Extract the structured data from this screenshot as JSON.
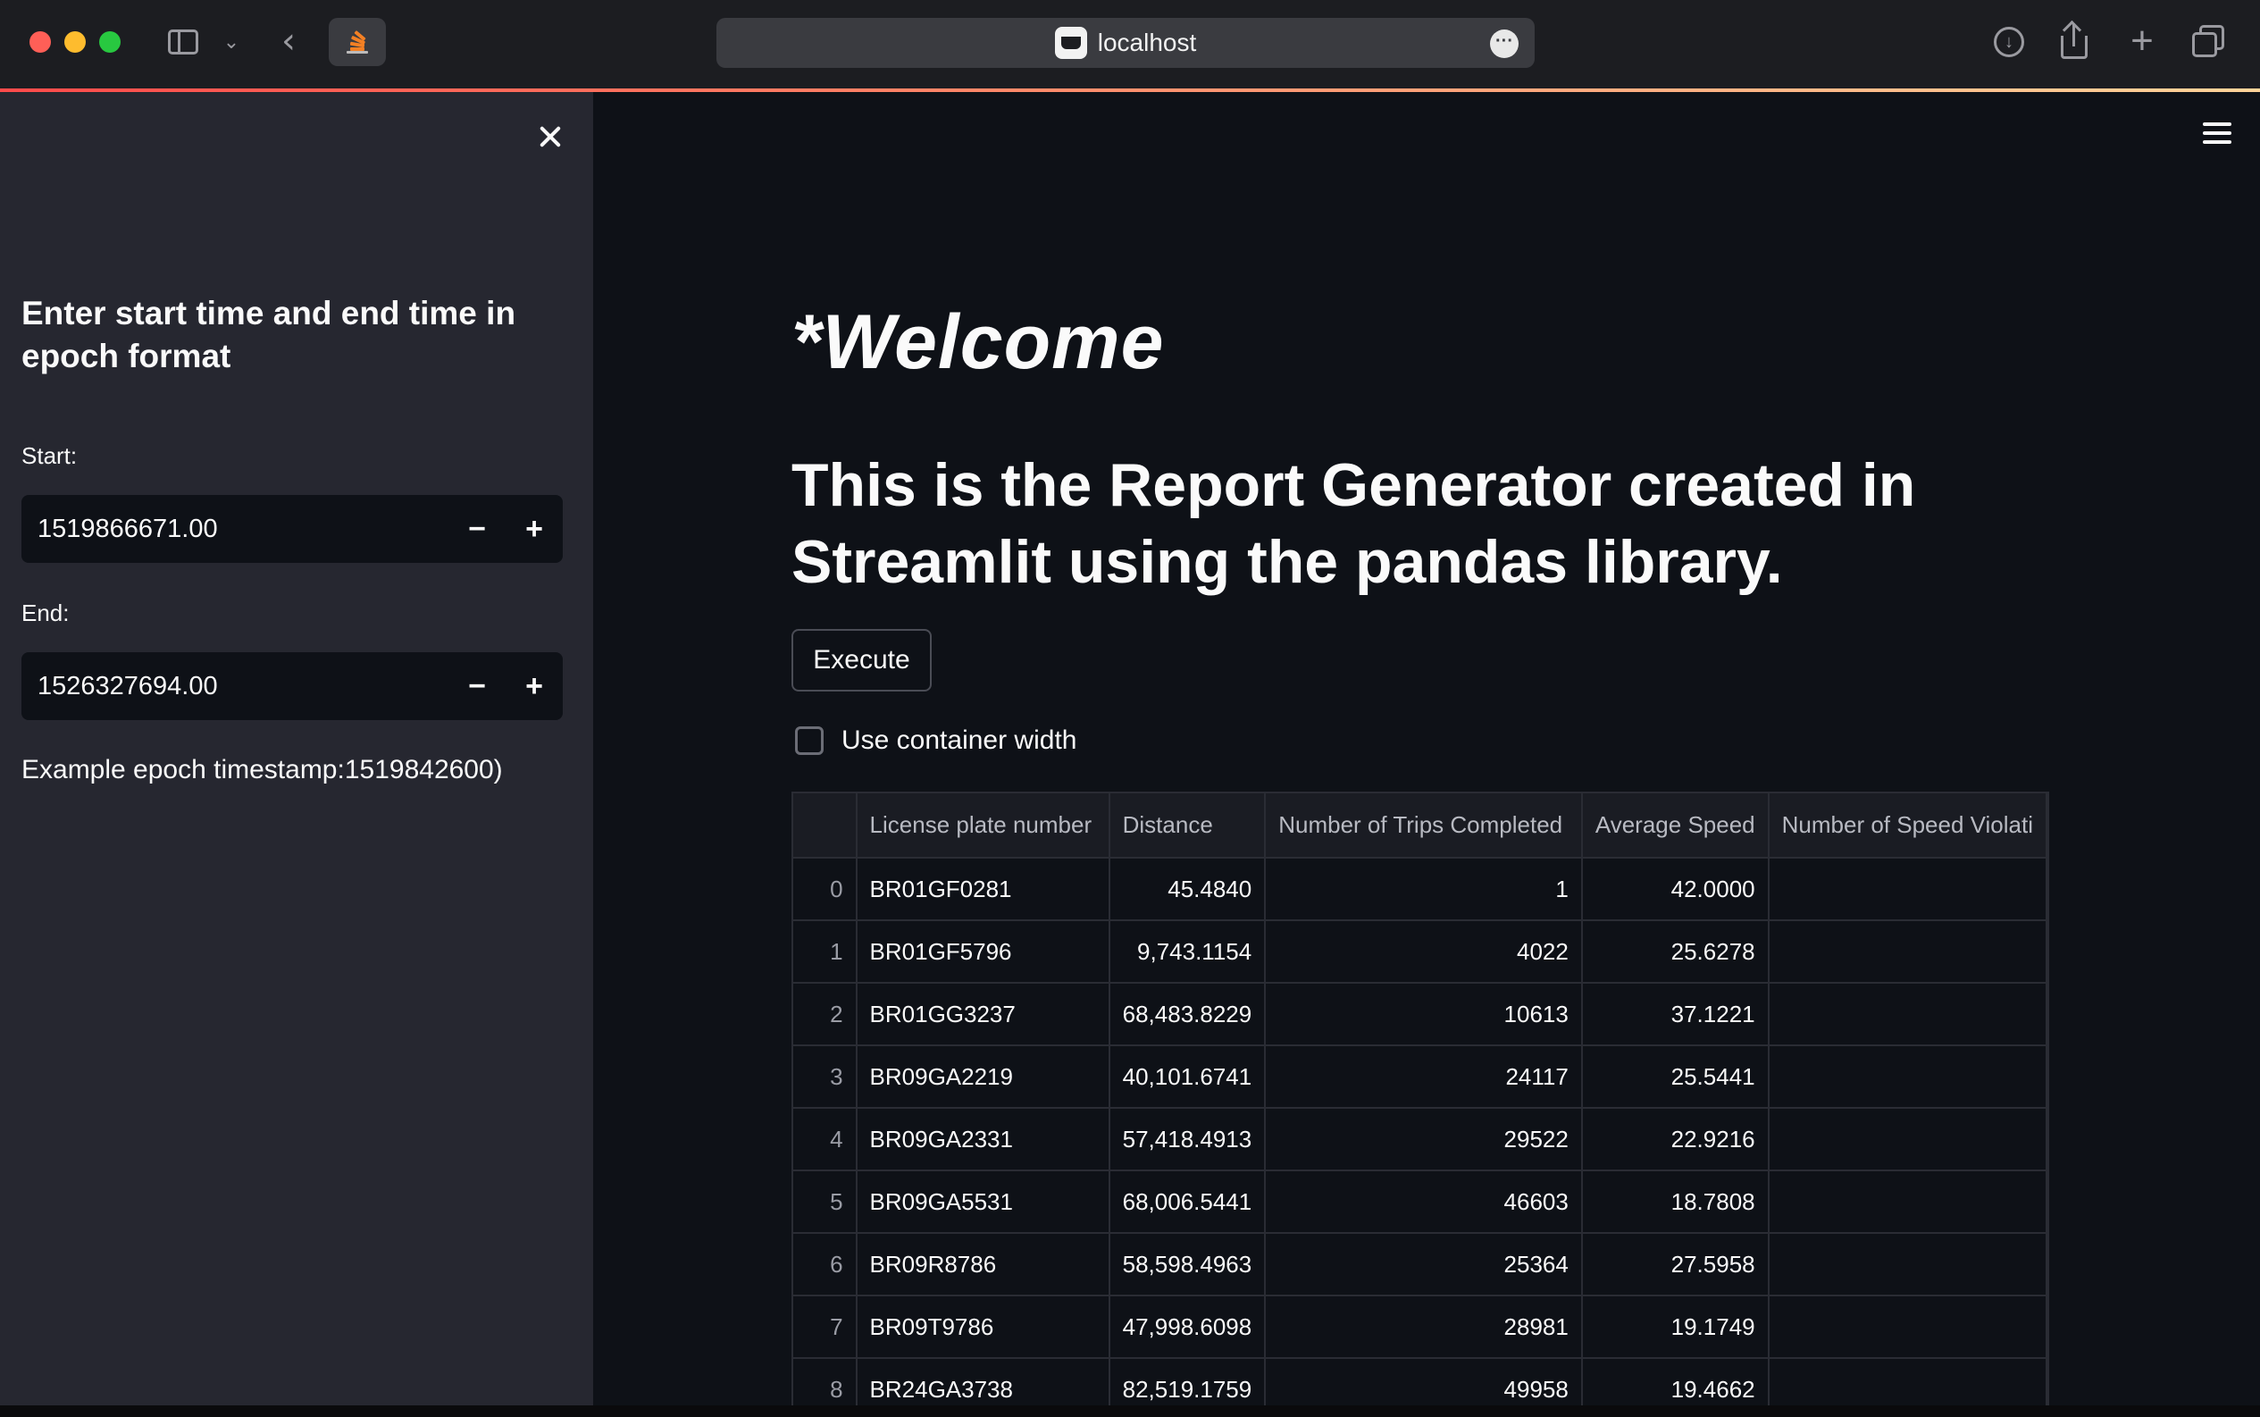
{
  "browser": {
    "url": "localhost",
    "icons": {
      "sidebar_toggle": "sidebar-toggle-icon",
      "chevron": "chevron-down-icon",
      "back": "back-arrow-icon",
      "download": "download-icon",
      "share": "share-icon",
      "new_tab": "plus-icon",
      "tab_overview": "tab-overview-icon"
    },
    "back_glyph": "‹",
    "chevron_glyph": "⌄",
    "more_glyph": "···",
    "download_glyph": "↓",
    "plus_glyph": "+"
  },
  "sidebar": {
    "heading": "Enter start time and end time in epoch format",
    "start_label": "Start:",
    "start_value": "1519866671.00",
    "end_label": "End:",
    "end_value": "1526327694.00",
    "minus": "−",
    "plus": "+",
    "hint": "Example epoch timestamp:1519842600)"
  },
  "main": {
    "welcome": "*Welcome",
    "subtitle": "This is the Report Generator created in Streamlit using the pandas library.",
    "execute_label": "Execute",
    "checkbox_label": "Use container width",
    "checkbox_checked": false
  },
  "table": {
    "columns": [
      "",
      "License plate number",
      "Distance",
      "Number of Trips Completed",
      "Average Speed",
      "Number of Speed Violati"
    ],
    "rows": [
      [
        "0",
        "BR01GF0281",
        "45.4840",
        "1",
        "42.0000",
        ""
      ],
      [
        "1",
        "BR01GF5796",
        "9,743.1154",
        "4022",
        "25.6278",
        ""
      ],
      [
        "2",
        "BR01GG3237",
        "68,483.8229",
        "10613",
        "37.1221",
        ""
      ],
      [
        "3",
        "BR09GA2219",
        "40,101.6741",
        "24117",
        "25.5441",
        ""
      ],
      [
        "4",
        "BR09GA2331",
        "57,418.4913",
        "29522",
        "22.9216",
        ""
      ],
      [
        "5",
        "BR09GA5531",
        "68,006.5441",
        "46603",
        "18.7808",
        ""
      ],
      [
        "6",
        "BR09R8786",
        "58,598.4963",
        "25364",
        "27.5958",
        ""
      ],
      [
        "7",
        "BR09T9786",
        "47,998.6098",
        "28981",
        "19.1749",
        ""
      ],
      [
        "8",
        "BR24GA3738",
        "82,519.1759",
        "49958",
        "19.4662",
        ""
      ]
    ]
  },
  "colors": {
    "app_background": "#0e1117",
    "sidebar_background": "#262730",
    "accent_gradient_start": "#ff4b4b",
    "accent_gradient_end": "#ffd49a"
  }
}
